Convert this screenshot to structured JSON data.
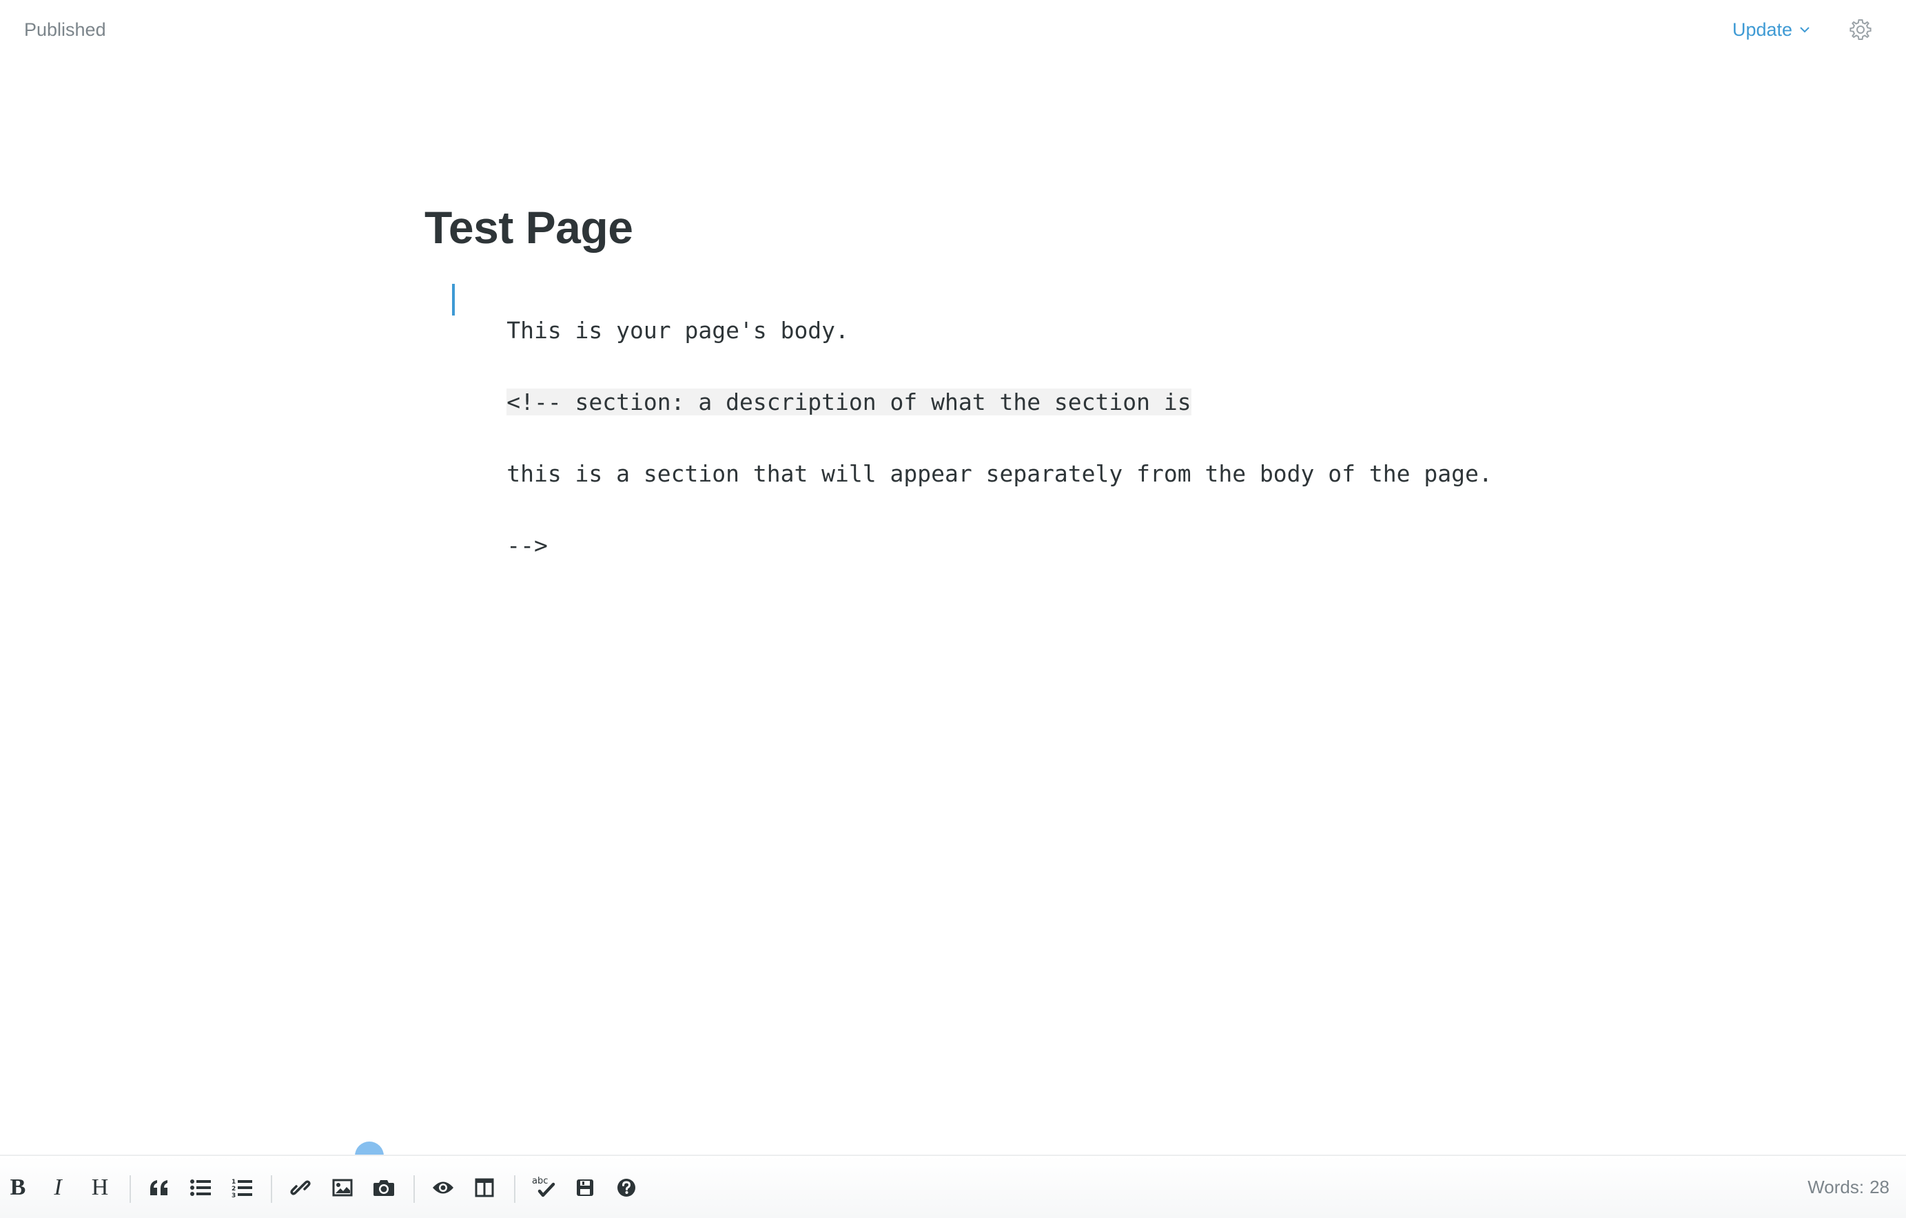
{
  "header": {
    "status": "Published",
    "update_label": "Update",
    "update_icon": "chevron-down-icon",
    "settings_icon": "gear-icon"
  },
  "document": {
    "title": "Test Page",
    "lines": [
      "This is your page's body.",
      "<!-- section: a description of what the section is",
      "this is a section that will appear separately from the body of the page.",
      "-->"
    ]
  },
  "toolbar": {
    "buttons": [
      {
        "name": "bold",
        "icon": "bold-icon",
        "glyph": "B"
      },
      {
        "name": "italic",
        "icon": "italic-icon",
        "glyph": "I"
      },
      {
        "name": "heading",
        "icon": "heading-icon",
        "glyph": "H"
      },
      {
        "name": "quote",
        "icon": "quote-icon"
      },
      {
        "name": "unordered-list",
        "icon": "bullet-list-icon"
      },
      {
        "name": "ordered-list",
        "icon": "numbered-list-icon"
      },
      {
        "name": "link",
        "icon": "link-icon"
      },
      {
        "name": "image",
        "icon": "image-icon"
      },
      {
        "name": "upload-photo",
        "icon": "camera-icon"
      },
      {
        "name": "preview",
        "icon": "eye-icon"
      },
      {
        "name": "side-by-side",
        "icon": "columns-icon"
      },
      {
        "name": "spellcheck",
        "icon": "spellcheck-icon",
        "glyph": "abc"
      },
      {
        "name": "save",
        "icon": "save-icon"
      },
      {
        "name": "help",
        "icon": "question-icon"
      }
    ],
    "word_count_label": "Words:",
    "word_count": "28"
  },
  "colors": {
    "accent": "#3e9ad4",
    "text": "#2e3538",
    "muted": "#7c858b"
  }
}
